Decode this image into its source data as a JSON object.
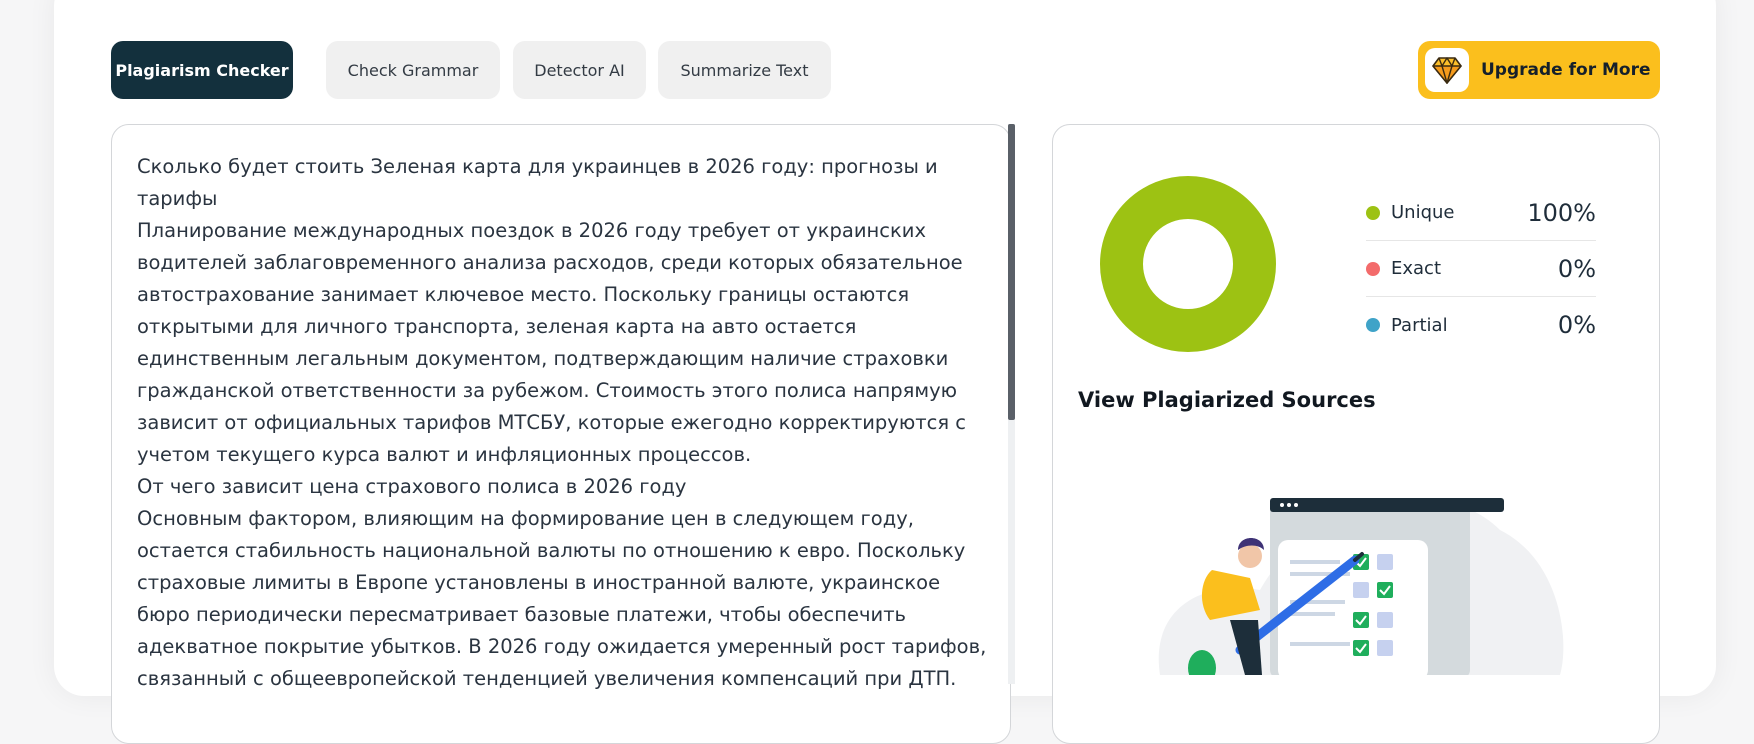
{
  "tabs": [
    {
      "label": "Plagiarism Checker",
      "active": true
    },
    {
      "label": "Check Grammar",
      "active": false
    },
    {
      "label": "Detector AI",
      "active": false
    },
    {
      "label": "Summarize Text",
      "active": false
    }
  ],
  "upgrade": {
    "label": "Upgrade for More",
    "icon": "diamond-icon"
  },
  "editor": {
    "paragraphs": [
      "Сколько будет стоить Зеленая карта для украинцев в 2026 году: прогнозы и тарифы",
      "Планирование международных поездок в 2026 году требует от украинских водителей заблаговременного анализа расходов, среди которых обязательное автострахование занимает ключевое место. Поскольку границы остаются открытыми для личного транспорта, зеленая карта на авто остается единственным легальным документом, подтверждающим наличие страховки гражданской ответственности за рубежом. Стоимость этого полиса напрямую зависит от официальных тарифов МТСБУ, которые ежегодно корректируются с учетом текущего курса валют и инфляционных процессов.",
      "От чего зависит цена страхового полиса в 2026 году",
      "Основным фактором, влияющим на формирование цен в следующем году, остается стабильность национальной валюты по отношению к евро. Поскольку страховые лимиты в Европе установлены в иностранной валюте, украинское бюро периодически пересматривает базовые платежи, чтобы обеспечить адекватное покрытие убытков. В 2026 году ожидается умеренный рост тарифов, связанный с общеевропейской тенденцией увеличения компенсаций при ДТП."
    ]
  },
  "results": {
    "legend": [
      {
        "name": "Unique",
        "value": "100%",
        "color": "#9dc213"
      },
      {
        "name": "Exact",
        "value": "0%",
        "color": "#f36b6b"
      },
      {
        "name": "Partial",
        "value": "0%",
        "color": "#3fa3c8"
      }
    ],
    "donut_fraction_unique": 1.0,
    "sources_title": "View Plagiarized Sources"
  }
}
